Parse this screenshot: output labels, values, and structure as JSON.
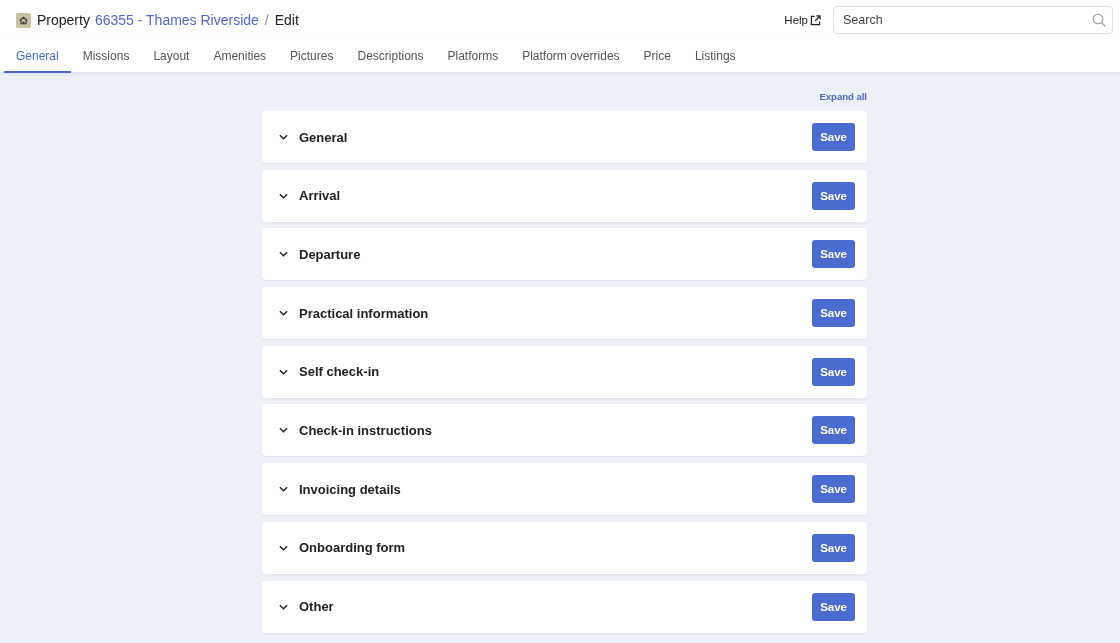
{
  "breadcrumb": {
    "prefix": "Property",
    "link": "66355 - Thames Riverside",
    "separator": "/",
    "current": "Edit"
  },
  "header": {
    "help": "Help",
    "search": {
      "placeholder": "Search"
    }
  },
  "tabs": [
    {
      "label": "General",
      "selected": true
    },
    {
      "label": "Missions",
      "selected": false
    },
    {
      "label": "Layout",
      "selected": false
    },
    {
      "label": "Amenities",
      "selected": false
    },
    {
      "label": "Pictures",
      "selected": false
    },
    {
      "label": "Descriptions",
      "selected": false
    },
    {
      "label": "Platforms",
      "selected": false
    },
    {
      "label": "Platform overrides",
      "selected": false
    },
    {
      "label": "Price",
      "selected": false
    },
    {
      "label": "Listings",
      "selected": false
    }
  ],
  "expand_all": "Expand all",
  "sections": [
    {
      "title": "General",
      "expanded": false,
      "button": "Save"
    },
    {
      "title": "Arrival",
      "expanded": false,
      "button": "Save"
    },
    {
      "title": "Departure",
      "expanded": false,
      "button": "Save"
    },
    {
      "title": "Practical information",
      "expanded": false,
      "button": "Save"
    },
    {
      "title": "Self check-in",
      "expanded": false,
      "button": "Save"
    },
    {
      "title": "Check-in instructions",
      "expanded": false,
      "button": "Save"
    },
    {
      "title": "Invoicing details",
      "expanded": false,
      "button": "Save"
    },
    {
      "title": "Onboarding form",
      "expanded": false,
      "button": "Save"
    },
    {
      "title": "Other",
      "expanded": false,
      "button": "Save"
    }
  ]
}
